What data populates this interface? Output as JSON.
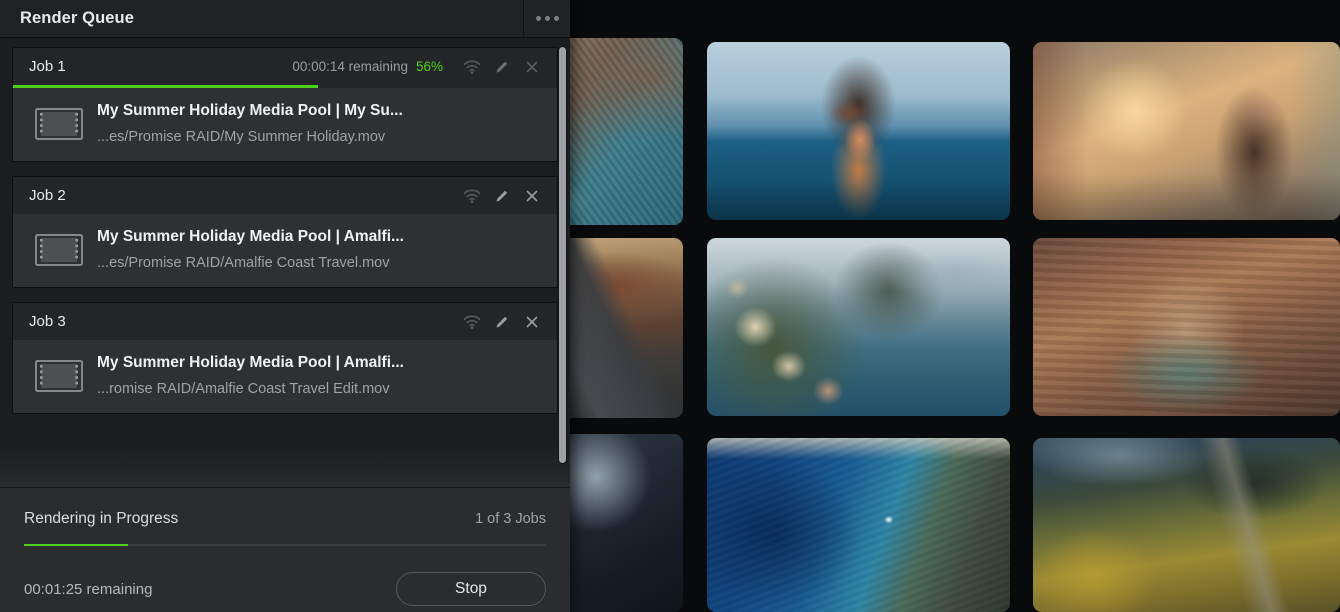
{
  "panel": {
    "title": "Render Queue",
    "overflow_menu": "•••"
  },
  "jobs": [
    {
      "name": "Job 1",
      "time_remaining": "00:00:14 remaining",
      "percent_label": "56%",
      "percent": 56,
      "title": "My Summer Holiday Media Pool  |  My Su...",
      "path": "...es/Promise RAID/My Summer Holiday.mov",
      "show_progress": true,
      "icons": [
        "broadcast-icon",
        "pencil-icon",
        "close-icon"
      ]
    },
    {
      "name": "Job 2",
      "time_remaining": "",
      "percent_label": "",
      "percent": 0,
      "title": "My Summer Holiday Media Pool  |  Amalfi...",
      "path": "...es/Promise RAID/Amalfie Coast Travel.mov",
      "show_progress": false,
      "icons": [
        "broadcast-icon",
        "pencil-icon",
        "close-icon"
      ]
    },
    {
      "name": "Job 3",
      "time_remaining": "",
      "percent_label": "",
      "percent": 0,
      "title": "My Summer Holiday Media Pool  |  Amalfi...",
      "path": "...romise RAID/Amalfie Coast Travel Edit.mov",
      "show_progress": false,
      "icons": [
        "broadcast-icon",
        "pencil-icon",
        "close-icon"
      ]
    }
  ],
  "footer": {
    "status": "Rendering in Progress",
    "jobs_count": "1 of 3 Jobs",
    "overall_percent": 20,
    "remaining": "00:01:25 remaining",
    "stop_label": "Stop"
  },
  "colors": {
    "accent_green": "#4fd21c",
    "panel_bg": "#1f2124",
    "card_bg": "#2e3134",
    "card_head_bg": "#232528",
    "text_primary": "#e9eaeb",
    "text_secondary": "#a0a2a5"
  },
  "media_grid": {
    "thumbnails": [
      {
        "name": "coastal-cliff-aerial",
        "row": 1,
        "col": 1
      },
      {
        "name": "woman-by-the-sea",
        "row": 1,
        "col": 2
      },
      {
        "name": "city-street-selfie",
        "row": 1,
        "col": 3
      },
      {
        "name": "desert-road",
        "row": 2,
        "col": 1
      },
      {
        "name": "amalfi-coast-town",
        "row": 2,
        "col": 2
      },
      {
        "name": "horseshoe-bend-canyon",
        "row": 2,
        "col": 3
      },
      {
        "name": "van-interior",
        "row": 3,
        "col": 1
      },
      {
        "name": "blue-bay-sailboat",
        "row": 3,
        "col": 2
      },
      {
        "name": "autumn-mountain-road",
        "row": 3,
        "col": 3
      }
    ]
  }
}
